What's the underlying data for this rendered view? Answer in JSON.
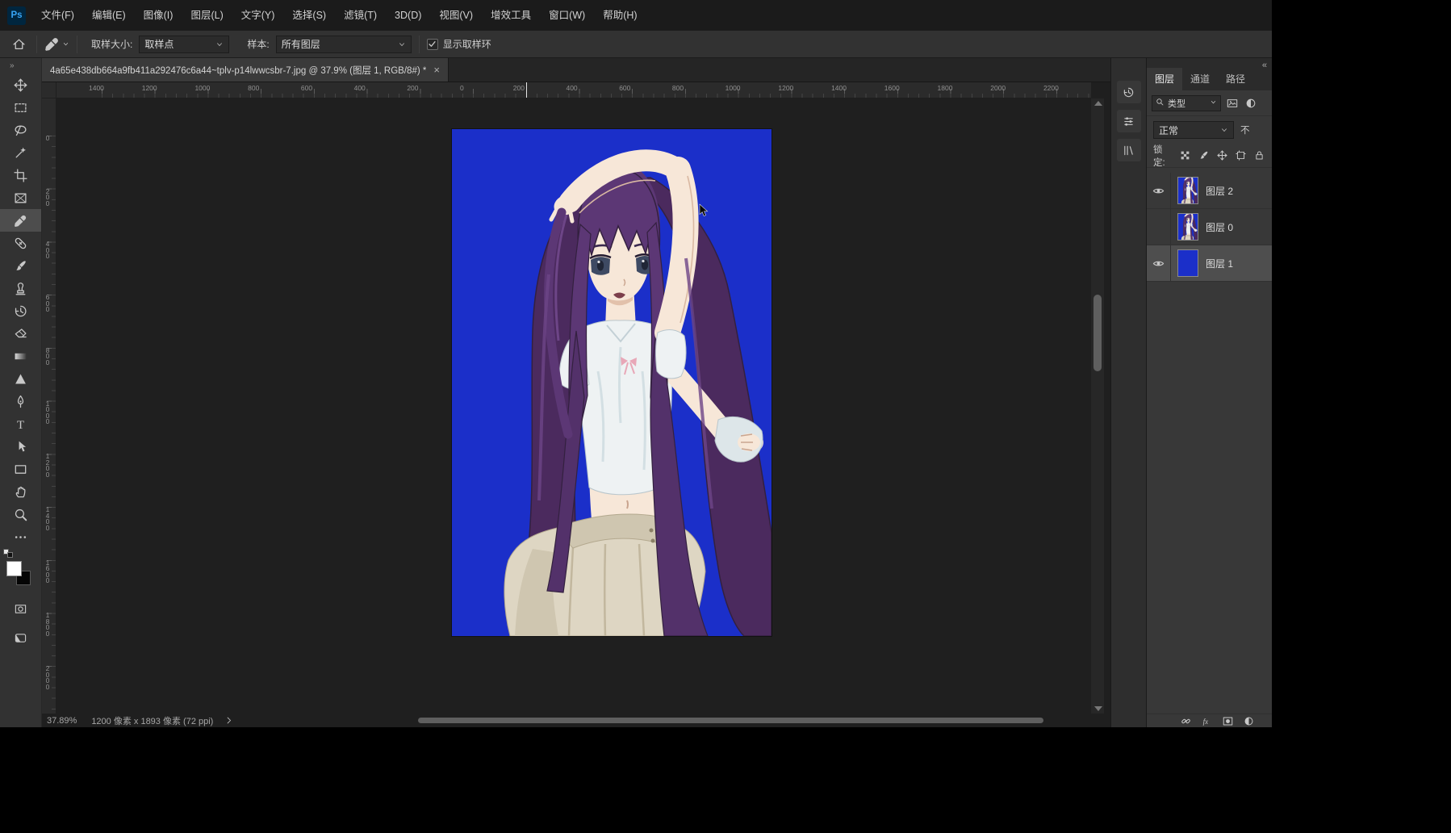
{
  "colors": {
    "accent_blue": "#1b2fc9"
  },
  "menu_bar": {
    "logo": "Ps",
    "items": [
      "文件(F)",
      "编辑(E)",
      "图像(I)",
      "图层(L)",
      "文字(Y)",
      "选择(S)",
      "滤镜(T)",
      "3D(D)",
      "视图(V)",
      "增效工具",
      "窗口(W)",
      "帮助(H)"
    ]
  },
  "options_bar": {
    "sample_size_label": "取样大小:",
    "sample_size_value": "取样点",
    "sample_label": "样本:",
    "sample_value": "所有图层",
    "show_sampling_ring_label": "显示取样环",
    "show_sampling_ring_checked": true
  },
  "document_tab": {
    "title": "4a65e438db664a9fb411a292476c6a44~tplv-p14lwwcsbr-7.jpg @ 37.9% (图层 1, RGB/8#) *",
    "close_label": "×"
  },
  "rulers": {
    "horizontal": [
      "1400",
      "1200",
      "1000",
      "800",
      "600",
      "400",
      "200",
      "0",
      "200",
      "400",
      "600",
      "800",
      "1000",
      "1200",
      "1400",
      "1600",
      "1800",
      "2000",
      "2200"
    ],
    "vertical": [
      "0",
      "200",
      "400",
      "600",
      "800",
      "1000",
      "1200",
      "1400",
      "1600",
      "1800",
      "2000"
    ]
  },
  "toolbar": {
    "expand_label": "»",
    "tools": [
      {
        "name": "move"
      },
      {
        "name": "marquee"
      },
      {
        "name": "lasso"
      },
      {
        "name": "object-selection"
      },
      {
        "name": "crop"
      },
      {
        "name": "frame"
      },
      {
        "name": "eyedropper",
        "active": true
      },
      {
        "name": "healing"
      },
      {
        "name": "brush"
      },
      {
        "name": "clone-stamp"
      },
      {
        "name": "history-brush"
      },
      {
        "name": "eraser"
      },
      {
        "name": "gradient"
      },
      {
        "name": "blur"
      },
      {
        "name": "pen"
      },
      {
        "name": "type"
      },
      {
        "name": "path-selection"
      },
      {
        "name": "shape"
      },
      {
        "name": "hand"
      },
      {
        "name": "zoom"
      },
      {
        "name": "edit-toolbar"
      }
    ]
  },
  "panel_strip": {
    "icons": [
      "strip-history",
      "strip-properties",
      "strip-libraries"
    ]
  },
  "layers_panel": {
    "collapse_label": "«",
    "tabs": [
      {
        "label": "图层",
        "active": true
      },
      {
        "label": "通道",
        "active": false
      },
      {
        "label": "路径",
        "active": false
      }
    ],
    "filter_type_label": "类型",
    "blend_mode_value": "正常",
    "opacity_label_partial": "不",
    "lock_label": "锁定:",
    "lock_icons": [
      "lock-transparent",
      "lock-brush",
      "lock-move",
      "lock-artboard",
      "lock-all"
    ],
    "layers": [
      {
        "name": "图层 2",
        "visible": true,
        "thumb": "artwork",
        "selected": false
      },
      {
        "name": "图层 0",
        "visible": false,
        "thumb": "artwork",
        "selected": false
      },
      {
        "name": "图层 1",
        "visible": true,
        "thumb": "blue",
        "selected": true
      }
    ],
    "footer_icons": [
      "link",
      "fx",
      "mask",
      "adjustment-filter"
    ]
  },
  "status_bar": {
    "zoom": "37.89%",
    "doc_size": "1200 像素 x 1893 像素 (72 ppi)"
  }
}
